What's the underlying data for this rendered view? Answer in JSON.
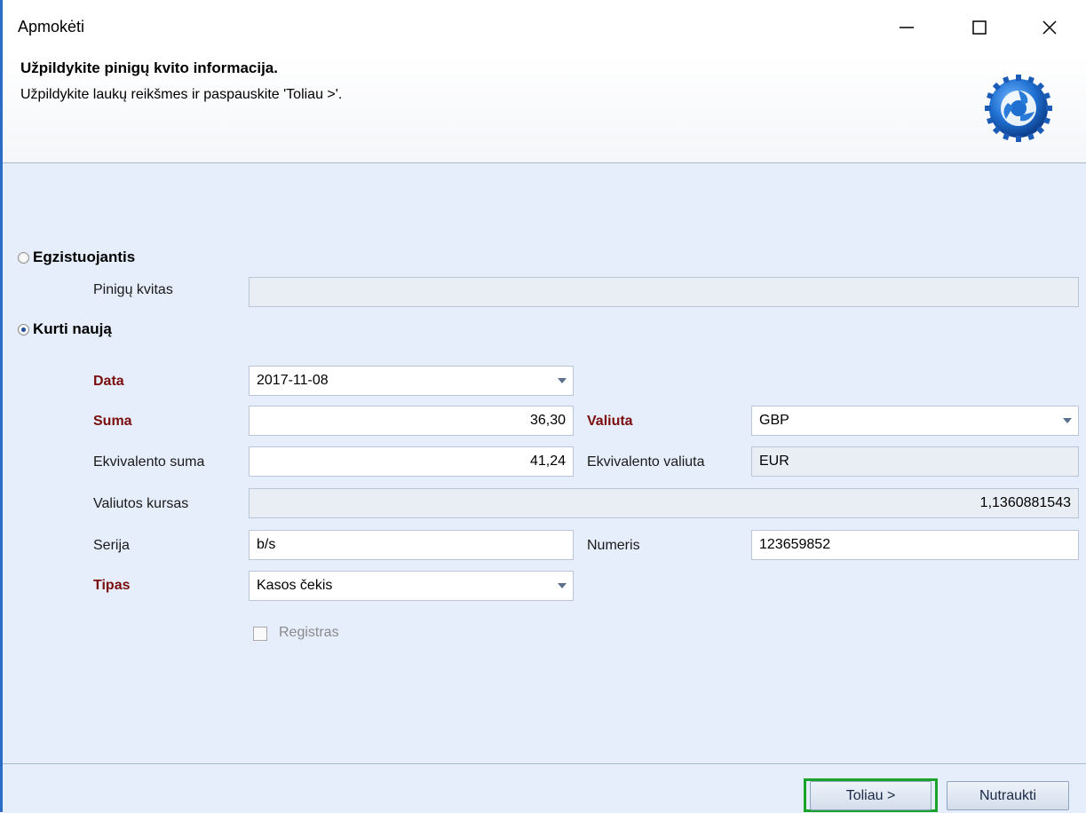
{
  "window": {
    "title": "Apmokėti"
  },
  "header": {
    "title": "Užpildykite pinigų kvito informacija.",
    "subtitle": "Užpildykite laukų reikšmes ir paspauskite 'Toliau >'."
  },
  "options": {
    "existing_label": "Egzistuojantis",
    "create_new_label": "Kurti naują",
    "selected": "create_new"
  },
  "existing": {
    "receipt_label": "Pinigų kvitas",
    "receipt_value": ""
  },
  "form": {
    "date": {
      "label": "Data",
      "value": "2017-11-08"
    },
    "amount": {
      "label": "Suma",
      "value": "36,30"
    },
    "currency": {
      "label": "Valiuta",
      "value": "GBP"
    },
    "equiv_amount": {
      "label": "Ekvivalento suma",
      "value": "41,24"
    },
    "equiv_currency": {
      "label": "Ekvivalento valiuta",
      "value": "EUR"
    },
    "rate": {
      "label": "Valiutos kursas",
      "value": "1,1360881543"
    },
    "series": {
      "label": "Serija",
      "value": "b/s"
    },
    "number": {
      "label": "Numeris",
      "value": "123659852"
    },
    "type": {
      "label": "Tipas",
      "value": "Kasos čekis"
    },
    "register": {
      "label": "Registras",
      "checked": false
    }
  },
  "buttons": {
    "next": "Toliau >",
    "cancel": "Nutraukti"
  },
  "colors": {
    "required_label": "#7a0d0d",
    "panel_bg": "#e6eefb",
    "highlight": "#1aa32b"
  }
}
